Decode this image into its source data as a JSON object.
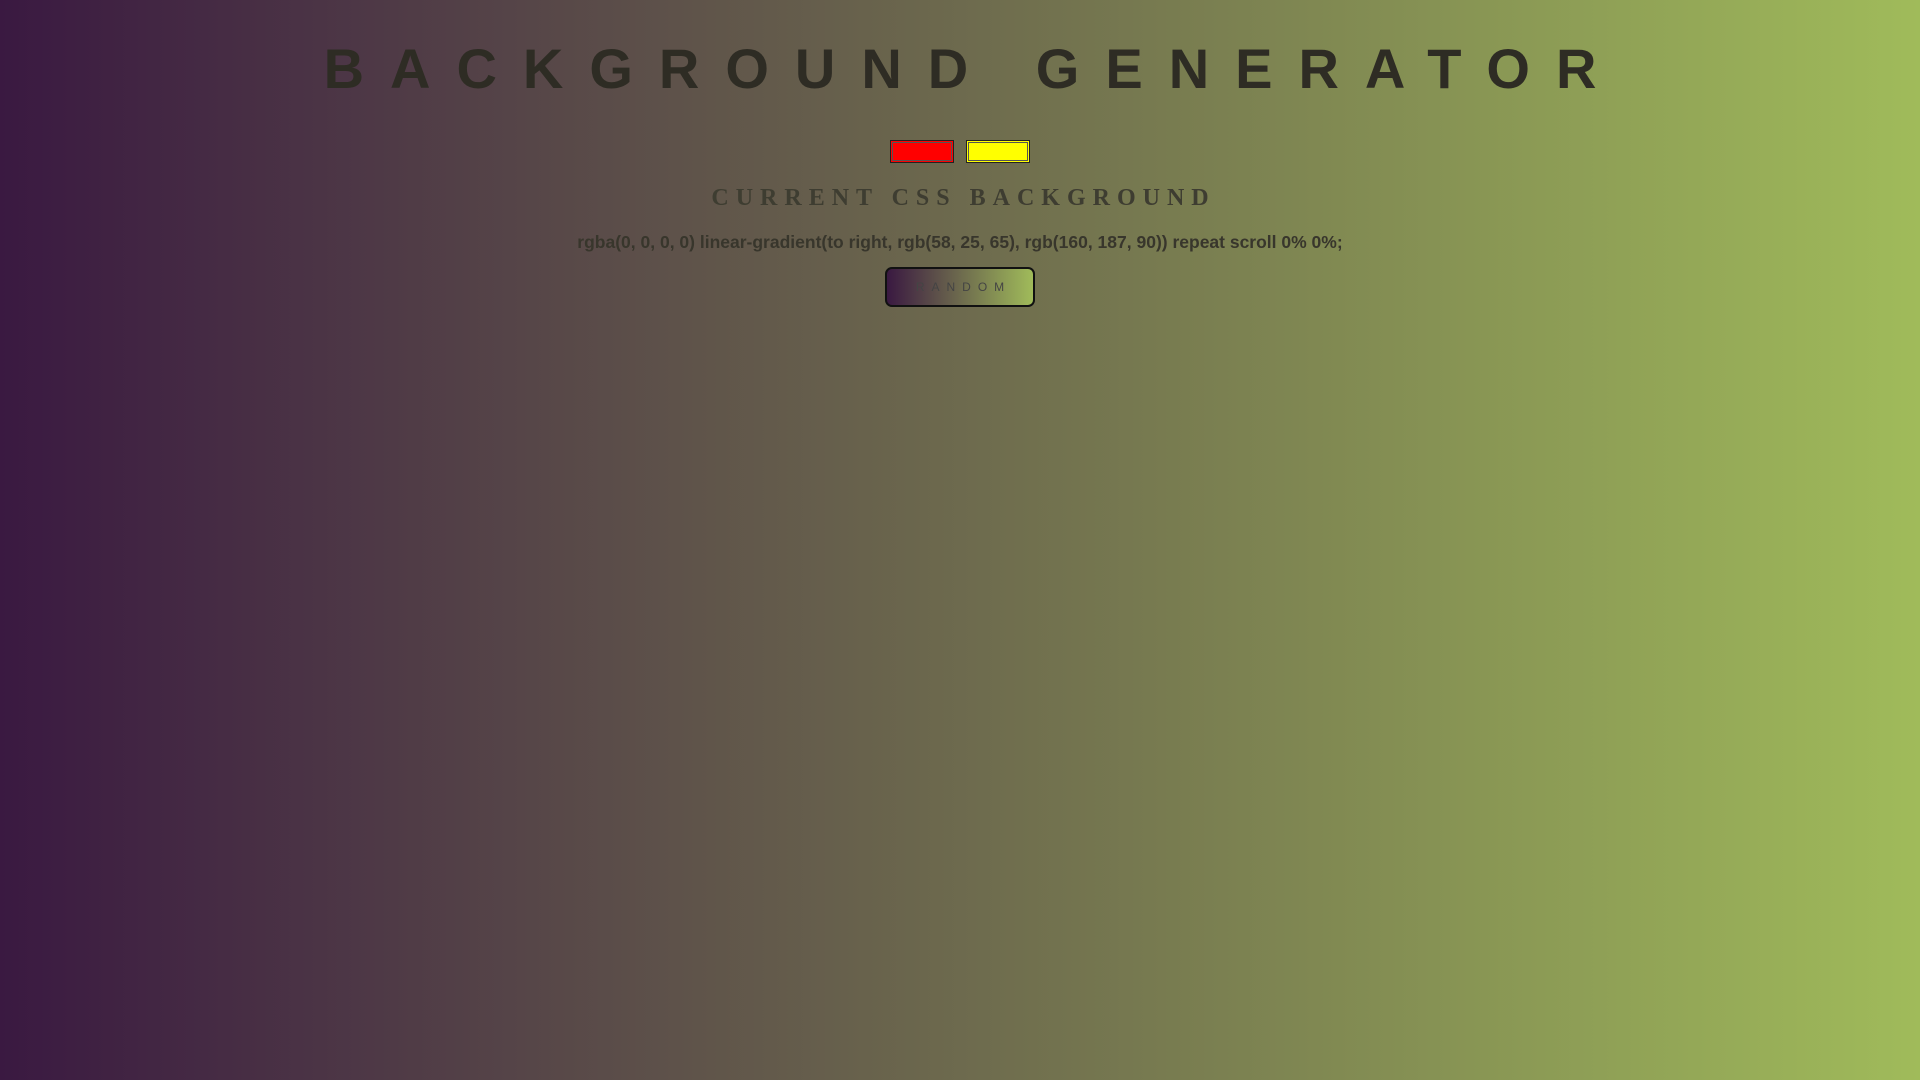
{
  "header": {
    "title": "BACKGROUND GENERATOR"
  },
  "colors": {
    "gradient_start": "#3a1941",
    "gradient_end": "#a0bb5a",
    "title_text": "#2e2c24",
    "subtitle_text": "#3e3d31",
    "css_text": "#38362c",
    "button_text": "#444444"
  },
  "pickers": {
    "color1": {
      "value": "#ff0000"
    },
    "color2": {
      "value": "#ffff00"
    }
  },
  "main": {
    "subtitle": "CURRENT CSS BACKGROUND",
    "css_value": "rgba(0, 0, 0, 0) linear-gradient(to right, rgb(58, 25, 65), rgb(160, 187, 90)) repeat scroll 0% 0%;",
    "random_label": "RANDOM"
  }
}
